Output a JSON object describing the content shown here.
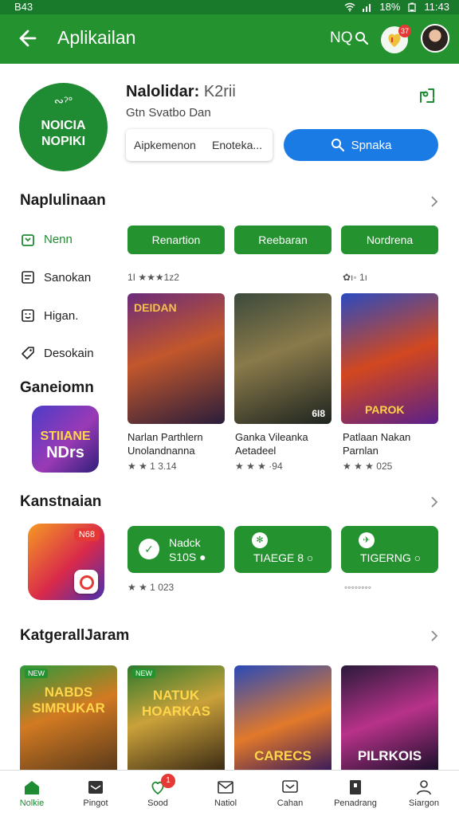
{
  "status_bar": {
    "time": "B43",
    "battery": "18%",
    "clock": "11:43"
  },
  "app_bar": {
    "title": "Aplikailan",
    "search_label": "NQ",
    "notification_badge": "37"
  },
  "app": {
    "logo_mark": "∾ˀ°",
    "logo_line1": "NOICIA",
    "logo_line2": "NOPIKI",
    "name": "Nalolidar:",
    "name_suffix": "K2rii",
    "subtitle": "Gtn  Svatbo Dan",
    "split_left": "Aipkemenon",
    "split_right": "Enoteka...",
    "install_label": "Spnaka"
  },
  "section1": {
    "title": "Naplulinaan",
    "side_items": [
      {
        "label": "Nenn",
        "active": true
      },
      {
        "label": "Sanokan",
        "active": false
      },
      {
        "label": "Higan.",
        "active": false
      },
      {
        "label": "Desokain",
        "active": false
      }
    ],
    "chips": [
      "Renartion",
      "Reebaran",
      "Nordrena"
    ],
    "meta_left": "1I ★★★1z2",
    "meta_right": "✿ı◦ 1ı",
    "cards": [
      {
        "overlay": "DEIDAN",
        "badge": "",
        "title": "Narlan Parthlern\nUnolandnanna",
        "rating": "★ ★ 1 3.14"
      },
      {
        "overlay": "",
        "badge": "6I8",
        "title": "Ganka Vileanka\nAetadeel",
        "rating": "★ ★ ★ ·94"
      },
      {
        "overlay": "PAROK",
        "badge": "",
        "title": "Patlaan Nakan\nParnlan",
        "rating": "★ ★ ★ 025"
      }
    ]
  },
  "section2": {
    "title": "Ganeiomn",
    "icon_line1": "STIIANE",
    "icon_line2": "NDrs"
  },
  "section3": {
    "title": "Kanstnaian",
    "promo_tag": "N68",
    "rating": "★ ★ 1 023",
    "buttons": [
      {
        "line1": "Nadck",
        "line2": "S10S ●"
      },
      {
        "line1": "",
        "line2": "TIAEGE 8 ○"
      },
      {
        "line1": "",
        "line2": "TIGERNG ○"
      }
    ],
    "meta_right": "◦◦◦◦◦◦◦◦"
  },
  "section4": {
    "title": "KatgerallJaram",
    "cards": [
      {
        "title": "NABDS SIMRUKAR",
        "tag": "NEW"
      },
      {
        "title": "NATUK HOARKAS",
        "tag": "NEW"
      },
      {
        "title": "CARECS",
        "tag": ""
      },
      {
        "title": "PILRKOIS",
        "tag": ""
      }
    ]
  },
  "bottom_nav": [
    {
      "label": "Nolkie",
      "icon": "home-icon",
      "active": true
    },
    {
      "label": "Pingot",
      "icon": "inbox-icon",
      "active": false
    },
    {
      "label": "Sood",
      "icon": "heart-icon",
      "active": false,
      "badge": "1"
    },
    {
      "label": "Natiol",
      "icon": "mail-icon",
      "active": false
    },
    {
      "label": "Cahan",
      "icon": "message-icon",
      "active": false
    },
    {
      "label": "Penadrang",
      "icon": "bookmark-icon",
      "active": false
    },
    {
      "label": "Siargon",
      "icon": "profile-icon",
      "active": false
    }
  ],
  "colors": {
    "primary_green": "#23922f",
    "install_blue": "#1b7be5",
    "badge_red": "#e53935"
  }
}
